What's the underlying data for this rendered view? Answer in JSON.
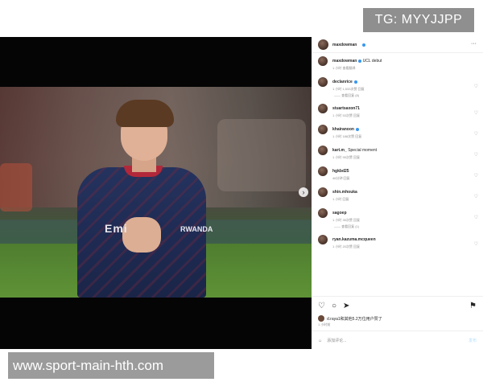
{
  "watermark": {
    "tg": "TG: MYYJJPP",
    "url": "www.sport-main-hth.com"
  },
  "post": {
    "author": "maxdowman",
    "jersey_sponsor": "Emi",
    "jersey_sponsor_right": "RWANDA",
    "comments": [
      {
        "user": "maxdowman",
        "text": "UCL debut",
        "meta": "1 小时   查看翻译"
      },
      {
        "user": "declanrice",
        "text": "",
        "meta": "1 小时   1,533次赞   回复",
        "replies": "—— 查看回复 (8)"
      },
      {
        "user": "stuartsaxon71",
        "text": "",
        "meta": "1 小时   53次赞   回复"
      },
      {
        "user": "khairanoon",
        "text": "",
        "meta": "1 小时   188次赞   回复"
      },
      {
        "user": "kart.m_",
        "text": "Special moment",
        "meta": "1 小时   95次赞   回复"
      },
      {
        "user": "hgkbd25",
        "text": "",
        "meta": "46分钟   回复"
      },
      {
        "user": "shin.mhouka",
        "text": "",
        "meta": "1 小时   回复"
      },
      {
        "user": "sagoep",
        "text": "",
        "meta": "1 小时   35次赞   回复",
        "replies": "—— 查看回复 (1)"
      },
      {
        "user": "ryan.kazuma.mcqueen",
        "text": "",
        "meta": "1 小时   20次赞   回复"
      }
    ],
    "likes_text": "d.raya1和其他5.2万位用户赞了",
    "date_text": "1 小时前",
    "add_comment_placeholder": "添加评论...",
    "post_label": "发布"
  }
}
